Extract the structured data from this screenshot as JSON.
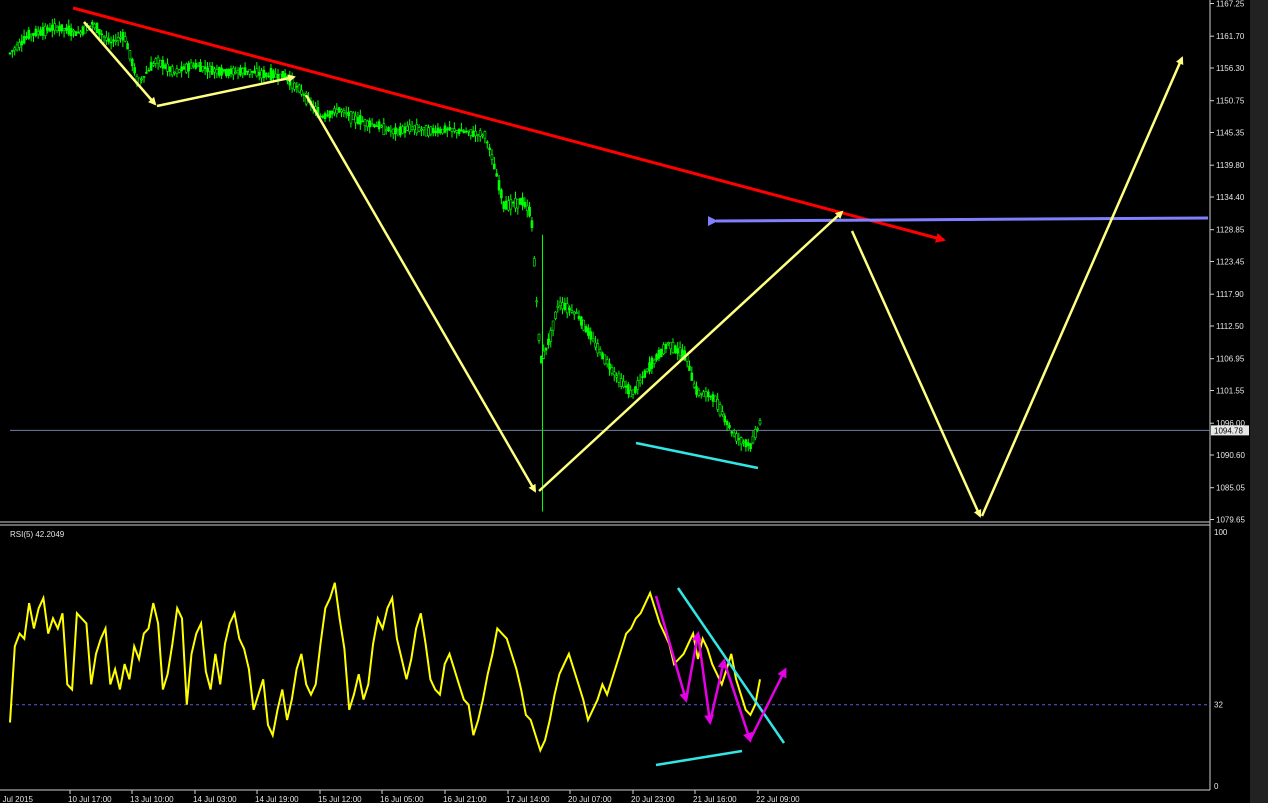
{
  "chart_data": [
    {
      "type": "candlestick",
      "title": "",
      "ylim": [
        1076.0,
        1168.5
      ],
      "y_ticks": [
        "1167.25",
        "1161.70",
        "1156.30",
        "1150.75",
        "1145.35",
        "1139.80",
        "1134.40",
        "1128.85",
        "1123.45",
        "1117.90",
        "1112.50",
        "1106.95",
        "1101.55",
        "1096.00",
        "1090.60",
        "1085.05",
        "1079.65"
      ],
      "current_price": "1094.78",
      "x_ticks": [
        "9 Jul 2015",
        "10 Jul 17:00",
        "13 Jul 10:00",
        "14 Jul 03:00",
        "14 Jul 19:00",
        "15 Jul 12:00",
        "16 Jul 05:00",
        "16 Jul 21:00",
        "17 Jul 14:00",
        "20 Jul 07:00",
        "20 Jul 23:00",
        "21 Jul 16:00",
        "22 Jul 09:00"
      ],
      "price_path": [
        [
          0,
          1158.8
        ],
        [
          4,
          1161.8
        ],
        [
          10,
          1163.2
        ],
        [
          15,
          1162.2
        ],
        [
          18,
          1163.8
        ],
        [
          22,
          1160.5
        ],
        [
          25,
          1161.9
        ],
        [
          28,
          1153.7
        ],
        [
          32,
          1157.6
        ],
        [
          36,
          1155.5
        ],
        [
          40,
          1156.8
        ],
        [
          44,
          1156.0
        ],
        [
          48,
          1155.6
        ],
        [
          52,
          1155.8
        ],
        [
          56,
          1155.1
        ],
        [
          60,
          1155.0
        ],
        [
          64,
          1152.1
        ],
        [
          68,
          1148.0
        ],
        [
          72,
          1149.2
        ],
        [
          76,
          1147.5
        ],
        [
          80,
          1146.6
        ],
        [
          84,
          1145.4
        ],
        [
          88,
          1146.2
        ],
        [
          92,
          1145.6
        ],
        [
          96,
          1145.8
        ],
        [
          100,
          1145.4
        ],
        [
          104,
          1144.9
        ],
        [
          106,
          1139.3
        ],
        [
          108,
          1133.0
        ],
        [
          112,
          1133.6
        ],
        [
          114,
          1131.4
        ],
        [
          116,
          1106.4
        ],
        [
          118,
          1110.2
        ],
        [
          120,
          1116.5
        ],
        [
          124,
          1114.6
        ],
        [
          128,
          1109.4
        ],
        [
          132,
          1104.7
        ],
        [
          136,
          1100.9
        ],
        [
          140,
          1105.7
        ],
        [
          144,
          1109.6
        ],
        [
          148,
          1107.1
        ],
        [
          150,
          1101.4
        ],
        [
          154,
          1100.4
        ],
        [
          158,
          1094.3
        ],
        [
          160,
          1093.0
        ],
        [
          162,
          1092.2
        ],
        [
          164,
          1096.3
        ]
      ],
      "rsi": {
        "label": "RSI(5) 42.2049",
        "ylim": [
          0,
          100
        ],
        "levels": [
          32
        ],
        "y_tick_labels": [
          "100",
          "32",
          "0"
        ],
        "values": [
          25,
          55,
          60,
          58,
          72,
          62,
          70,
          74,
          60,
          66,
          62,
          68,
          40,
          38,
          68,
          66,
          64,
          40,
          52,
          58,
          62,
          40,
          46,
          38,
          48,
          42,
          55,
          50,
          60,
          62,
          72,
          64,
          38,
          44,
          56,
          70,
          66,
          32,
          52,
          60,
          64,
          45,
          38,
          52,
          40,
          56,
          64,
          68,
          58,
          54,
          46,
          30,
          36,
          42,
          24,
          20,
          30,
          38,
          26,
          34,
          46,
          52,
          40,
          36,
          40,
          56,
          70,
          74,
          80,
          66,
          54,
          30,
          36,
          44,
          34,
          40,
          56,
          66,
          62,
          70,
          74,
          58,
          50,
          42,
          50,
          62,
          68,
          56,
          42,
          38,
          36,
          48,
          52,
          46,
          40,
          34,
          32,
          20,
          26,
          34,
          44,
          52,
          62,
          60,
          58,
          52,
          46,
          38,
          28,
          26,
          20,
          14,
          18,
          26,
          36,
          44,
          48,
          52,
          46,
          40,
          34,
          26,
          30,
          34,
          40,
          36,
          42,
          48,
          54,
          60,
          62,
          66,
          68,
          72,
          76,
          70,
          64,
          60,
          56,
          48,
          50,
          52,
          56,
          60,
          50,
          58,
          54,
          48,
          44,
          40,
          46,
          52,
          42,
          36,
          30,
          28,
          32,
          42
        ]
      }
    }
  ],
  "annotations": {
    "trendline_color": "#ff0000",
    "resistance_color": "#8080ff",
    "path_arrow_color": "#ffff80",
    "divergence_color": "#33e6e6",
    "rsi_arrow_color": "#e600e6",
    "bull_candle": "#00ff00",
    "rsi_line": "#ffff00"
  }
}
